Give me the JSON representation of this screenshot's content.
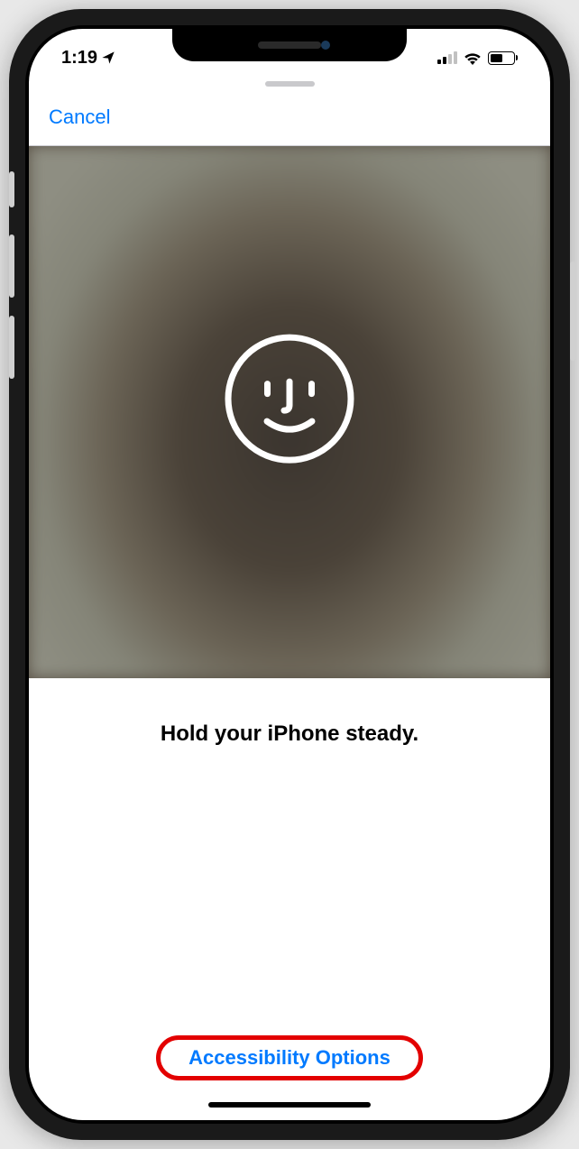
{
  "status_bar": {
    "time": "1:19",
    "location_active": true,
    "signal_strength": 2,
    "wifi_active": true,
    "battery_percent": 55
  },
  "nav": {
    "cancel_label": "Cancel"
  },
  "face_id": {
    "instruction": "Hold your iPhone steady.",
    "icon_name": "face-id-smiley"
  },
  "footer": {
    "accessibility_label": "Accessibility Options"
  },
  "annotation": {
    "highlighted": "accessibility-options"
  }
}
